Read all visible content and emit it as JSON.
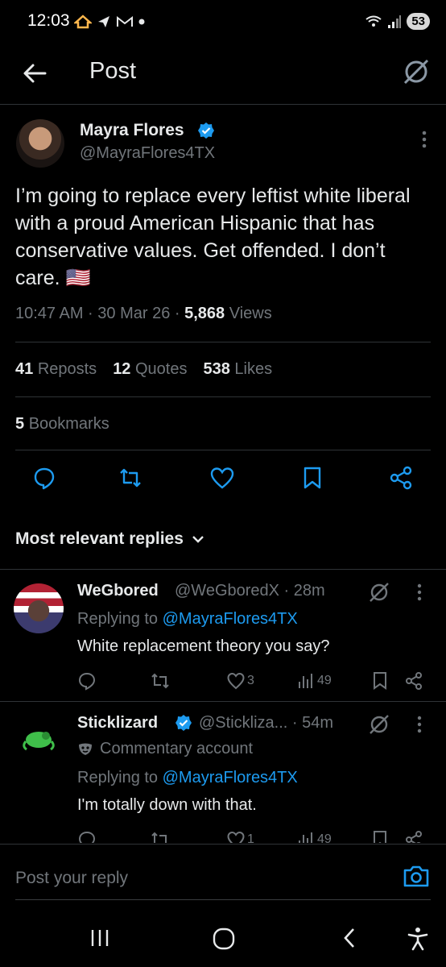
{
  "status_bar": {
    "time": "12:03",
    "battery": "53",
    "left_icons": [
      "home-icon",
      "send-icon",
      "gmail-icon",
      "dot-icon"
    ],
    "right_icons": [
      "wifi-icon",
      "signal-icon",
      "battery-icon"
    ]
  },
  "header": {
    "title": "Post",
    "icons": [
      "back-arrow-icon",
      "grok-icon"
    ]
  },
  "tweet": {
    "author_name": "Mayra Flores",
    "author_handle": "@MayraFlores4TX",
    "text": "I’m going to replace every leftist white liberal with a proud American Hispanic that has conservative values. Get offended. I don’t care. 🇺🇸",
    "time": "10:47 AM · 30 Mar 26 · ",
    "views_count": "5,868",
    "views_label": " Views",
    "reposts_count": "41",
    "reposts_label": "Reposts",
    "quotes_count": "12",
    "quotes_label": "Quotes",
    "likes_count": "538",
    "likes_label": "Likes",
    "bookmarks_count": "5",
    "bookmarks_label": "Bookmarks"
  },
  "replies_section": {
    "heading": "Most relevant replies"
  },
  "replies": [
    {
      "name": "WeGbored",
      "handle_time": "@WeGboredX · 28m",
      "replying_prefix": "Replying to ",
      "replying_to": "@MayraFlores4TX",
      "text": "White replacement theory you say?",
      "likes": "3",
      "views": "49"
    },
    {
      "name": "Sticklizard",
      "handle_time": "@Sticklizа... · 54m",
      "label": "Commentary account",
      "replying_prefix": "Replying to ",
      "replying_to": "@MayraFlores4TX",
      "text": "I'm totally down with that.",
      "likes": "1",
      "views": "49"
    }
  ],
  "composer": {
    "placeholder": "Post your reply"
  },
  "colors": {
    "background": "#000000",
    "text": "#e7e9ea",
    "muted": "#71767b",
    "accent": "#1d9bf0",
    "divider": "#2f3336"
  }
}
